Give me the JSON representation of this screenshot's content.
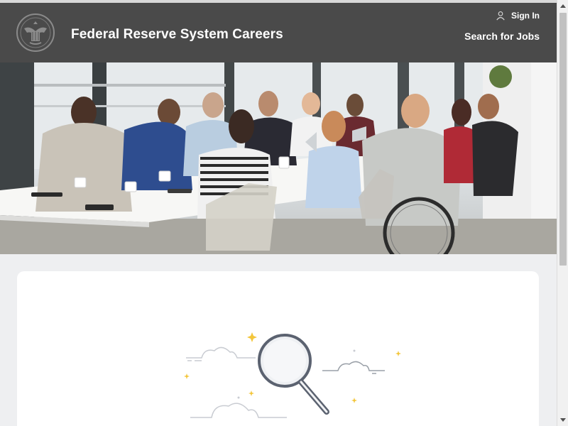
{
  "header": {
    "logo_icon": "federal-reserve-seal-icon",
    "title": "Federal Reserve System Careers",
    "signin_label": "Sign In",
    "signin_icon": "user-icon",
    "search_jobs_label": "Search for Jobs",
    "background_color": "#4a4a4a"
  },
  "hero": {
    "image": "people-in-meeting-room-photo"
  },
  "content_card": {
    "illustration": "magnifying-glass-icon",
    "accent_color": "#f3c63b"
  },
  "colors": {
    "page_background": "#eeeff1",
    "card_background": "#ffffff"
  }
}
